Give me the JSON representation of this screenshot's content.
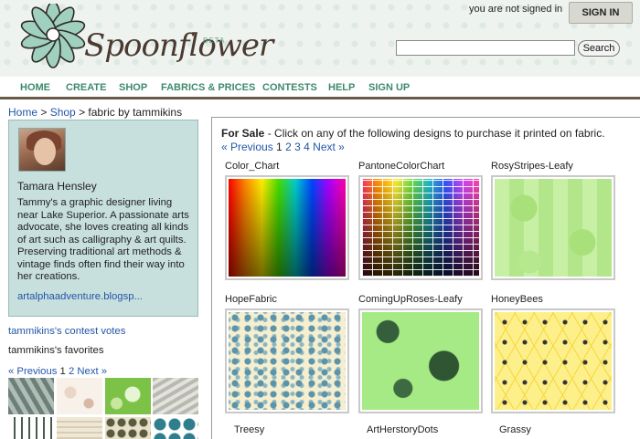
{
  "header": {
    "logo_text": "Spoonflower",
    "logo_beta": "BETA",
    "signed_status": "you are not signed in",
    "signin_label": "SIGN IN",
    "search_placeholder": "",
    "search_button": "Search"
  },
  "nav": [
    "HOME",
    "CREATE",
    "SHOP",
    "FABRICS & PRICES",
    "CONTESTS",
    "HELP",
    "SIGN UP"
  ],
  "breadcrumb": {
    "home": "Home",
    "sep1": " > ",
    "shop": "Shop",
    "rest": " > fabric by tammikins"
  },
  "profile": {
    "name": "Tamara Hensley",
    "bio": "Tammy's a graphic designer living near Lake Superior. A passionate arts advocate, she loves creating all kinds of art such as calligraphy & art quilts. Preserving traditional art methods & vintage finds often find their way into her creations.",
    "link": "artalphaadventure.blogsp..."
  },
  "sidebar": {
    "contest_votes": "tammikins's contest votes",
    "favorites": "tammikins's favorites",
    "fav_prev": "« Previous",
    "fav_page1": "1",
    "fav_page2": "2",
    "fav_next": "Next »"
  },
  "main": {
    "forsale_bold": "For Sale",
    "forsale_text": " - Click on any of the following designs to purchase it printed on fabric.",
    "pager_prev": "« Previous",
    "pages": [
      "1",
      "2",
      "3",
      "4"
    ],
    "pager_next": "Next »",
    "designs": [
      {
        "title": "Color_Chart"
      },
      {
        "title": "PantoneColorChart"
      },
      {
        "title": "RosyStripes-Leafy"
      },
      {
        "title": "HopeFabric"
      },
      {
        "title": "ComingUpRoses-Leafy"
      },
      {
        "title": "HoneyBees"
      },
      {
        "title": "Treesy"
      },
      {
        "title": "ArtHerstoryDots"
      },
      {
        "title": "Grassy"
      }
    ]
  }
}
